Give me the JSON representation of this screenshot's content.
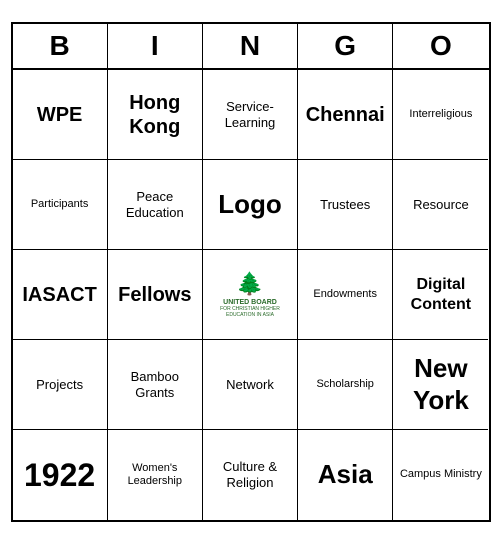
{
  "header": {
    "letters": [
      "B",
      "I",
      "N",
      "G",
      "O"
    ]
  },
  "cells": [
    {
      "id": "r1c1",
      "text": "WPE",
      "size": "large"
    },
    {
      "id": "r1c2",
      "text": "Hong Kong",
      "size": "large"
    },
    {
      "id": "r1c3",
      "text": "Service-Learning",
      "size": "normal"
    },
    {
      "id": "r1c4",
      "text": "Chennai",
      "size": "large"
    },
    {
      "id": "r1c5",
      "text": "Interreligious",
      "size": "small"
    },
    {
      "id": "r2c1",
      "text": "Participants",
      "size": "small"
    },
    {
      "id": "r2c2",
      "text": "Peace Education",
      "size": "normal"
    },
    {
      "id": "r2c3",
      "text": "Logo",
      "size": "xlarge"
    },
    {
      "id": "r2c4",
      "text": "Trustees",
      "size": "normal"
    },
    {
      "id": "r2c5",
      "text": "Resource",
      "size": "normal"
    },
    {
      "id": "r3c1",
      "text": "IASACT",
      "size": "large"
    },
    {
      "id": "r3c2",
      "text": "Fellows",
      "size": "large"
    },
    {
      "id": "r3c3",
      "text": "UNITED_BOARD_LOGO",
      "size": "logo"
    },
    {
      "id": "r3c4",
      "text": "Endowments",
      "size": "small"
    },
    {
      "id": "r3c5",
      "text": "Digital Content",
      "size": "large"
    },
    {
      "id": "r4c1",
      "text": "Projects",
      "size": "normal"
    },
    {
      "id": "r4c2",
      "text": "Bamboo Grants",
      "size": "normal"
    },
    {
      "id": "r4c3",
      "text": "Network",
      "size": "normal"
    },
    {
      "id": "r4c4",
      "text": "Scholarship",
      "size": "small"
    },
    {
      "id": "r4c5",
      "text": "New York",
      "size": "xlarge"
    },
    {
      "id": "r5c1",
      "text": "1922",
      "size": "xxlarge"
    },
    {
      "id": "r5c2",
      "text": "Women's Leadership",
      "size": "small"
    },
    {
      "id": "r5c3",
      "text": "Culture & Religion",
      "size": "normal"
    },
    {
      "id": "r5c4",
      "text": "Asia",
      "size": "xlarge"
    },
    {
      "id": "r5c5",
      "text": "Campus Ministry",
      "size": "small"
    }
  ],
  "united_board": {
    "line1": "UNITED BOARD",
    "line2": "FOR CHRISTIAN HIGHER EDUCATION IN ASIA"
  }
}
